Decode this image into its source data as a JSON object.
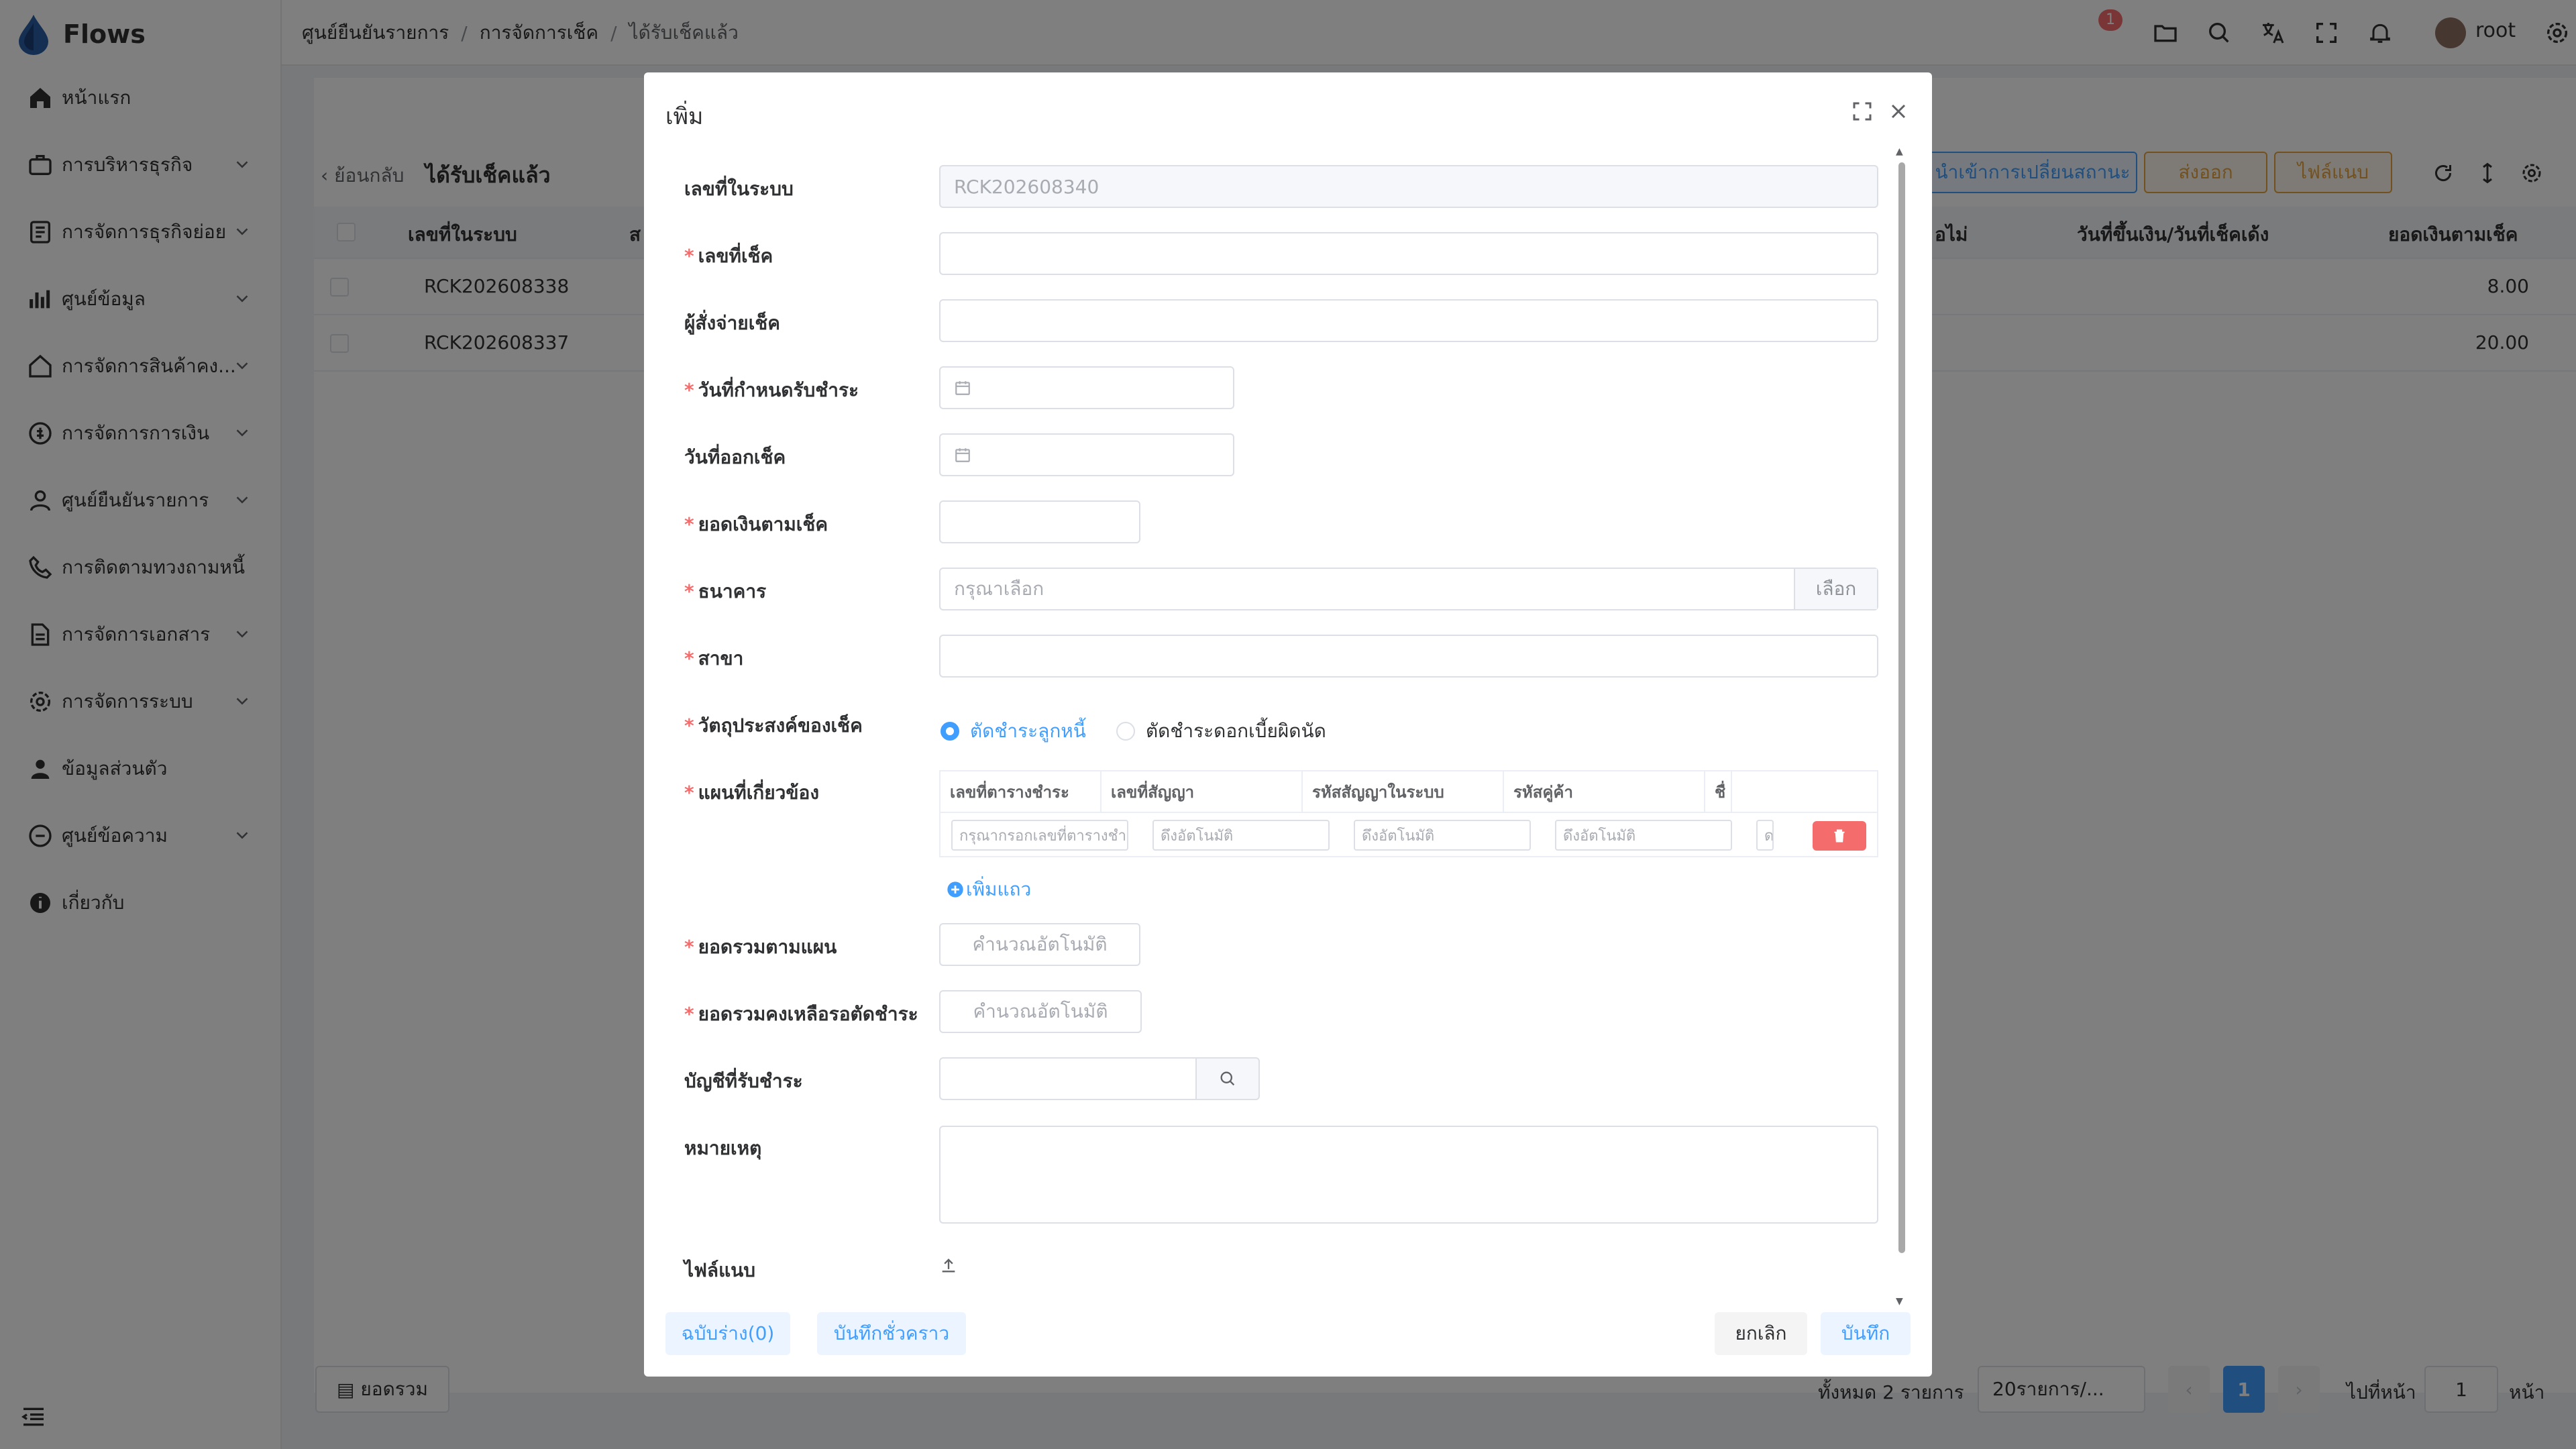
{
  "app": {
    "name": "Flows"
  },
  "sidebar": {
    "items": [
      {
        "label": "หน้าแรก",
        "icon": "home-icon"
      },
      {
        "label": "การบริหารธุรกิจ",
        "icon": "briefcase-icon"
      },
      {
        "label": "การจัดการธุรกิจย่อย",
        "icon": "document-icon"
      },
      {
        "label": "ศูนย์ข้อมูล",
        "icon": "chart-icon"
      },
      {
        "label": "การจัดการสินค้าคง...",
        "icon": "house-icon"
      },
      {
        "label": "การจัดการการเงิน",
        "icon": "money-icon"
      },
      {
        "label": "ศูนย์ยืนยันรายการ",
        "icon": "user-check-icon"
      },
      {
        "label": "การติดตามทวงถามหนี้",
        "icon": "phone-icon"
      },
      {
        "label": "การจัดการเอกสาร",
        "icon": "file-icon"
      },
      {
        "label": "การจัดการระบบ",
        "icon": "gear-icon"
      },
      {
        "label": "ข้อมูลส่วนตัว",
        "icon": "person-icon"
      },
      {
        "label": "ศูนย์ข้อความ",
        "icon": "message-icon"
      },
      {
        "label": "เกี่ยวกับ",
        "icon": "info-icon"
      }
    ]
  },
  "header": {
    "breadcrumb": [
      "ศูนย์ยืนยันรายการ",
      "การจัดการเช็ค",
      "ได้รับเช็คแล้ว"
    ],
    "notification_count": "1",
    "username": "root"
  },
  "page": {
    "back_label": "ย้อนกลับ",
    "title": "ได้รับเช็คแล้ว",
    "toolbar": {
      "status_change": "นำเข้าการเปลี่ยนสถานะ",
      "export": "ส่งออก",
      "attachment": "ไฟล์แนบ"
    },
    "table": {
      "columns": [
        "เลขที่ในระบบ",
        "ส",
        "อไม่",
        "วันที่ขึ้นเงิน/วันที่เช็คเด้ง",
        "ยอดเงินตามเช็ค"
      ],
      "rows": [
        {
          "system_no": "RCK202608338",
          "amount": "8.00"
        },
        {
          "system_no": "RCK202608337",
          "amount": "20.00"
        }
      ]
    },
    "footer": {
      "summary": "ยอดรวม",
      "total": "ทั้งหมด 2 รายการ",
      "page_size": "20รายการ/...",
      "current_page": "1",
      "goto_label": "ไปที่หน้า",
      "goto_value": "1",
      "page_suffix": "หน้า"
    }
  },
  "dialog": {
    "title": "เพิ่ม",
    "fields": {
      "system_no": {
        "label": "เลขที่ในระบบ",
        "value": "RCK202608340"
      },
      "cheque_no": {
        "label": "เลขที่เช็ค",
        "value": ""
      },
      "payer": {
        "label": "ผู้สั่งจ่ายเช็ค",
        "value": ""
      },
      "due_date": {
        "label": "วันที่กำหนดรับชำระ",
        "value": ""
      },
      "issue_date": {
        "label": "วันที่ออกเช็ค",
        "value": ""
      },
      "amount": {
        "label": "ยอดเงินตามเช็ค",
        "value": ""
      },
      "bank": {
        "label": "ธนาคาร",
        "placeholder": "กรุณาเลือก",
        "button": "เลือก"
      },
      "branch": {
        "label": "สาขา",
        "value": ""
      },
      "purpose": {
        "label": "วัตถุประสงค์ของเช็ค",
        "options": [
          "ตัดชำระลูกหนี้",
          "ตัดชำระดอกเบี้ยผิดนัด"
        ],
        "selected": "ตัดชำระลูกหนี้"
      },
      "plans": {
        "label": "แผนที่เกี่ยวข้อง",
        "columns": [
          "เลขที่ตารางชำระ",
          "เลขที่สัญญา",
          "รหัสสัญญาในระบบ",
          "รหัสคู่ค้า",
          "ชื่"
        ],
        "row_placeholders": [
          "กรุณากรอกเลขที่ตารางชำ",
          "ดึงอัตโนมัติ",
          "ดึงอัตโนมัติ",
          "ดึงอัตโนมัติ",
          "ด"
        ],
        "add_row": "เพิ่มแถว"
      },
      "plan_total": {
        "label": "ยอดรวมตามแผน",
        "placeholder": "คำนวณอัตโนมัติ"
      },
      "remaining_total": {
        "label": "ยอดรวมคงเหลือรอตัดชำระ",
        "placeholder": "คำนวณอัตโนมัติ"
      },
      "account": {
        "label": "บัญชีที่รับชำระ",
        "value": ""
      },
      "note": {
        "label": "หมายเหตุ",
        "value": ""
      },
      "attachment": {
        "label": "ไฟล์แนบ"
      }
    },
    "buttons": {
      "draft": "ฉบับร่าง(0)",
      "temp_save": "บันทึกชั่วคราว",
      "cancel": "ยกเลิก",
      "save": "บันทึก"
    }
  },
  "colors": {
    "primary": "#409eff",
    "danger": "#f56c6c",
    "warning": "#e6a23c"
  }
}
